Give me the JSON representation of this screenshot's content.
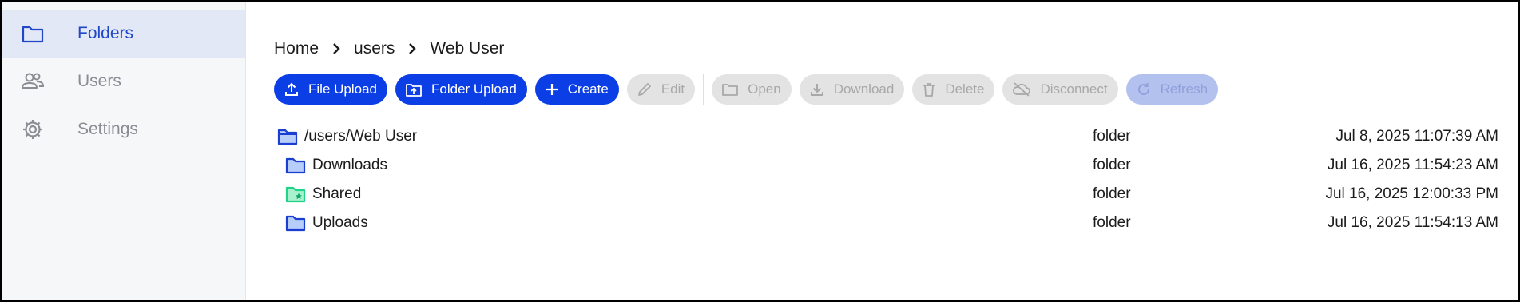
{
  "sidebar": {
    "items": [
      {
        "label": "Folders",
        "icon": "folder-icon",
        "active": true
      },
      {
        "label": "Users",
        "icon": "users-icon",
        "active": false
      },
      {
        "label": "Settings",
        "icon": "gear-icon",
        "active": false
      }
    ]
  },
  "breadcrumb": [
    "Home",
    "users",
    "Web User"
  ],
  "toolbar": {
    "file_upload": "File Upload",
    "folder_upload": "Folder Upload",
    "create": "Create",
    "edit": "Edit",
    "open": "Open",
    "download": "Download",
    "delete": "Delete",
    "disconnect": "Disconnect",
    "refresh": "Refresh"
  },
  "files": [
    {
      "name": "/users/Web User",
      "type": "folder",
      "date": "Jul 8, 2025 11:07:39 AM",
      "icon": "folder-open-icon"
    },
    {
      "name": "Downloads",
      "type": "folder",
      "date": "Jul 16, 2025 11:54:23 AM",
      "icon": "folder-icon"
    },
    {
      "name": "Shared",
      "type": "folder",
      "date": "Jul 16, 2025 12:00:33 PM",
      "icon": "shared-folder-icon"
    },
    {
      "name": "Uploads",
      "type": "folder",
      "date": "Jul 16, 2025 11:54:13 AM",
      "icon": "folder-icon"
    }
  ],
  "colors": {
    "primary": "#0c3ee5",
    "sidebar_active_bg": "#e3e8f7",
    "sidebar_active_text": "#1f47c8",
    "folder_fill": "#b7cdfa",
    "folder_stroke": "#1a3fd0",
    "shared_folder": "#1fd488"
  }
}
